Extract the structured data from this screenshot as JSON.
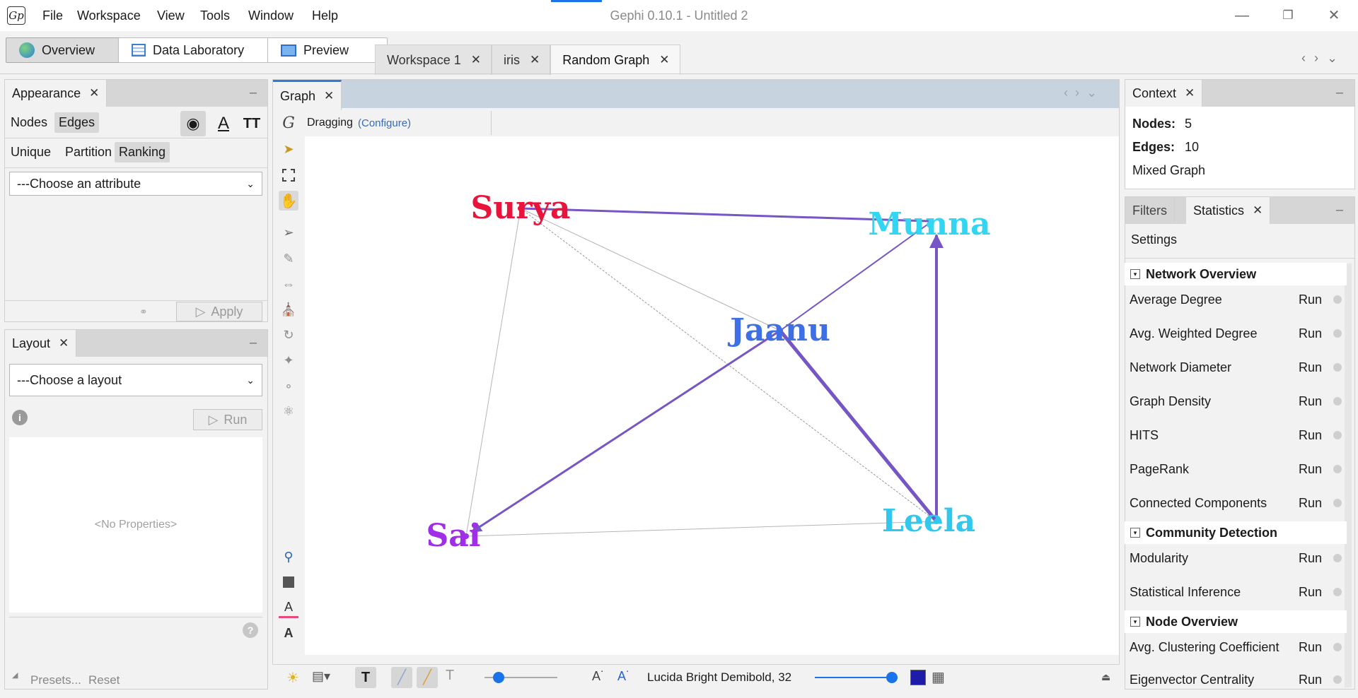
{
  "window": {
    "title": "Gephi 0.10.1 - Untitled 2",
    "logo": "Gp"
  },
  "menu": [
    "File",
    "Workspace",
    "View",
    "Tools",
    "Window",
    "Help"
  ],
  "modes": {
    "overview": "Overview",
    "data_lab": "Data Laboratory",
    "preview": "Preview"
  },
  "doc_tabs": [
    "Workspace 1",
    "iris",
    "Random Graph"
  ],
  "appearance": {
    "tab": "Appearance",
    "nodes": "Nodes",
    "edges": "Edges",
    "unique": "Unique",
    "partition": "Partition",
    "ranking": "Ranking",
    "attribute_placeholder": "---Choose an attribute",
    "apply": "Apply"
  },
  "layout": {
    "tab": "Layout",
    "choose": "---Choose a layout",
    "run": "Run",
    "no_props": "<No Properties>",
    "presets": "Presets...",
    "reset": "Reset"
  },
  "graph": {
    "tab": "Graph",
    "mode": "Dragging",
    "configure": "(Configure)",
    "nodes": [
      {
        "label": "Surya",
        "color": "#e8143c"
      },
      {
        "label": "Munna",
        "color": "#33d6f2"
      },
      {
        "label": "Jaanu",
        "color": "#3f6fe4"
      },
      {
        "label": "Leela",
        "color": "#32c7ec"
      },
      {
        "label": "Sai",
        "color": "#a02ee6"
      }
    ],
    "edge_color": "#7656c4",
    "font_label": "Lucida Bright Demibold, 32",
    "node_color_swatch": "#1c1ca8"
  },
  "context": {
    "tab": "Context",
    "nodes_label": "Nodes:",
    "nodes_value": "5",
    "edges_label": "Edges:",
    "edges_value": "10",
    "graph_type": "Mixed Graph"
  },
  "stats": {
    "filters_tab": "Filters",
    "stats_tab": "Statistics",
    "settings": "Settings",
    "sections": [
      {
        "title": "Network Overview",
        "items": [
          "Average Degree",
          "Avg. Weighted Degree",
          "Network Diameter",
          "Graph Density",
          "HITS",
          "PageRank",
          "Connected Components"
        ]
      },
      {
        "title": "Community Detection",
        "items": [
          "Modularity",
          "Statistical Inference"
        ]
      },
      {
        "title": "Node Overview",
        "items": [
          "Avg. Clustering Coefficient",
          "Eigenvector Centrality"
        ]
      }
    ],
    "run": "Run"
  }
}
